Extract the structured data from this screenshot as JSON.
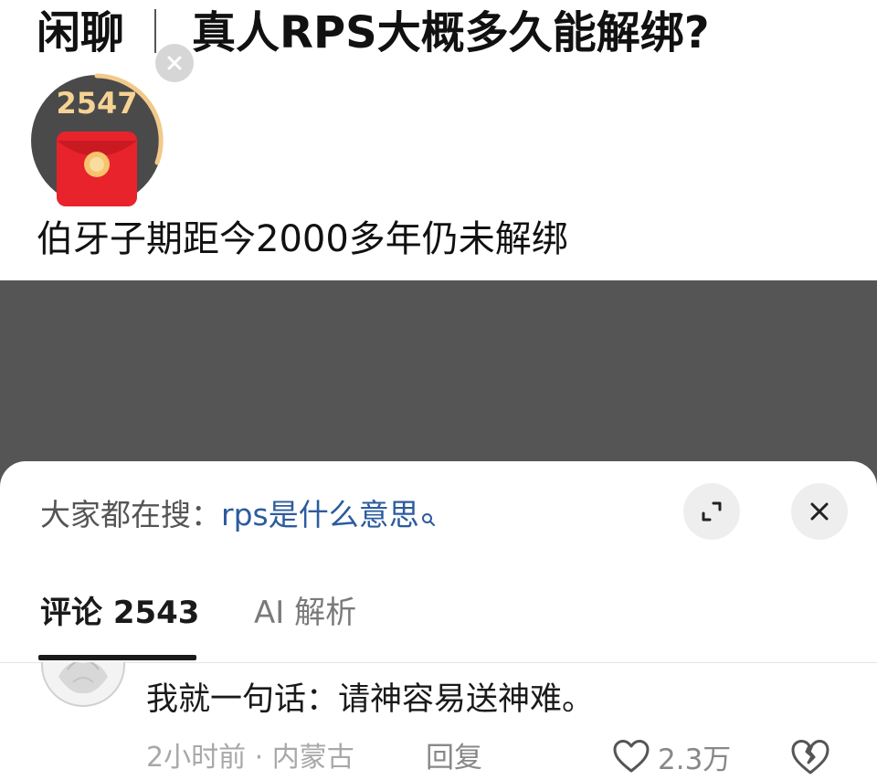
{
  "post": {
    "category": "闲聊",
    "separator": "｜",
    "title": "真人RPS大概多久能解绑?",
    "body": "伯牙子期距今2000多年仍未解绑"
  },
  "hongbao": {
    "count": "2547",
    "icon": "red-envelope-icon"
  },
  "search_suggest": {
    "label": "大家都在搜：",
    "query": "rps是什么意思"
  },
  "tabs": [
    {
      "label": "评论 2543",
      "active": true
    },
    {
      "label": "AI 解析",
      "active": false
    }
  ],
  "comment": {
    "text": "我就一句话：请神容易送神难。",
    "time": "2小时前",
    "dot": "·",
    "location": "内蒙古",
    "reply_label": "回复",
    "likes": "2.3万"
  },
  "colors": {
    "accent_link": "#2c5b9e",
    "envelope_red": "#e8232c",
    "ring_gold": "#f2c98a"
  }
}
